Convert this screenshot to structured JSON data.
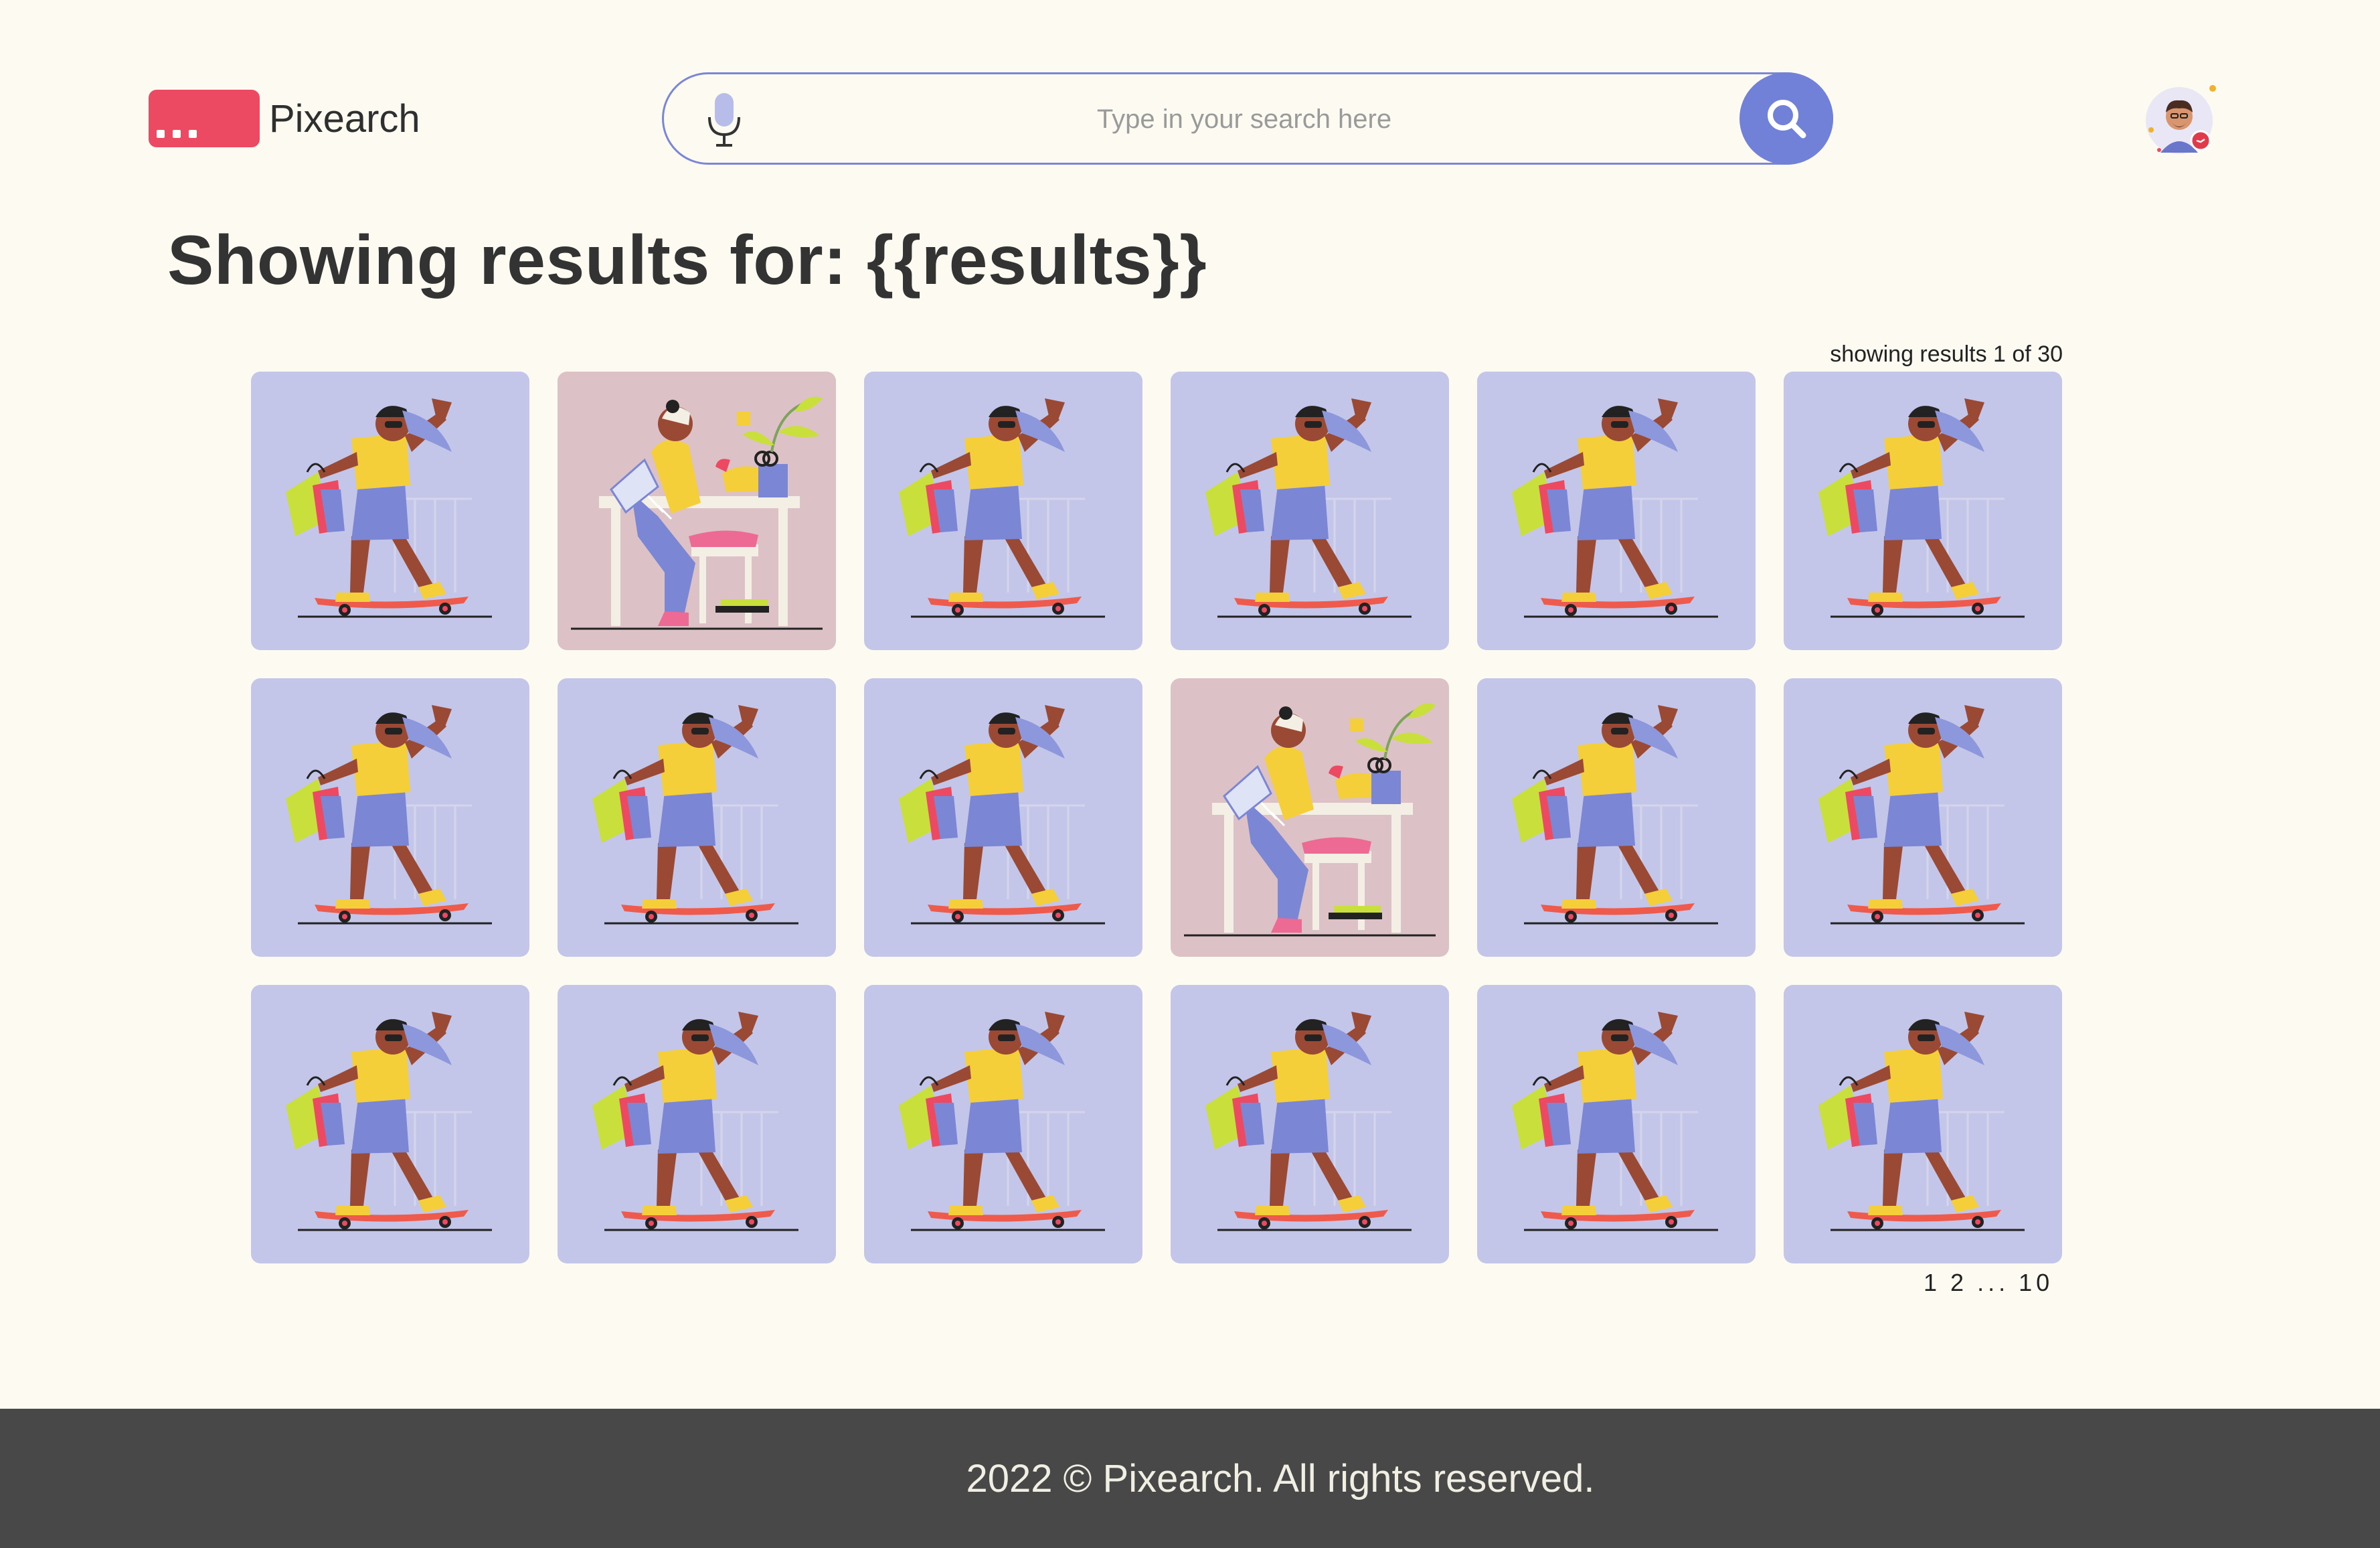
{
  "brand": {
    "name": "Pixearch",
    "color": "#ec4a63"
  },
  "search": {
    "placeholder": "Type in your search here",
    "mic_icon": "microphone-icon",
    "button_icon": "search-icon",
    "accent": "#7281d8"
  },
  "user": {
    "avatar_icon": "user-avatar-icon"
  },
  "results": {
    "title": "Showing results for: {{results}}",
    "count_label": "showing results 1 of 30",
    "items": [
      {
        "type": "skateboarder-shopping-illustration"
      },
      {
        "type": "woman-laptop-desk-illustration"
      },
      {
        "type": "skateboarder-shopping-illustration"
      },
      {
        "type": "skateboarder-shopping-illustration"
      },
      {
        "type": "skateboarder-shopping-illustration"
      },
      {
        "type": "skateboarder-shopping-illustration"
      },
      {
        "type": "skateboarder-shopping-illustration"
      },
      {
        "type": "skateboarder-shopping-illustration"
      },
      {
        "type": "skateboarder-shopping-illustration"
      },
      {
        "type": "woman-laptop-desk-illustration"
      },
      {
        "type": "skateboarder-shopping-illustration"
      },
      {
        "type": "skateboarder-shopping-illustration"
      },
      {
        "type": "skateboarder-shopping-illustration"
      },
      {
        "type": "skateboarder-shopping-illustration"
      },
      {
        "type": "skateboarder-shopping-illustration"
      },
      {
        "type": "skateboarder-shopping-illustration"
      },
      {
        "type": "skateboarder-shopping-illustration"
      },
      {
        "type": "skateboarder-shopping-illustration"
      }
    ]
  },
  "pagination": {
    "pages": [
      "1",
      "2",
      "...",
      "10"
    ]
  },
  "footer": {
    "text": "2022 © Pixearch. All rights reserved."
  },
  "colors": {
    "background": "#fdfbf1",
    "tile_skate": "#c3c6e8",
    "tile_desk": "#dcc2c6",
    "footer": "#484848"
  }
}
